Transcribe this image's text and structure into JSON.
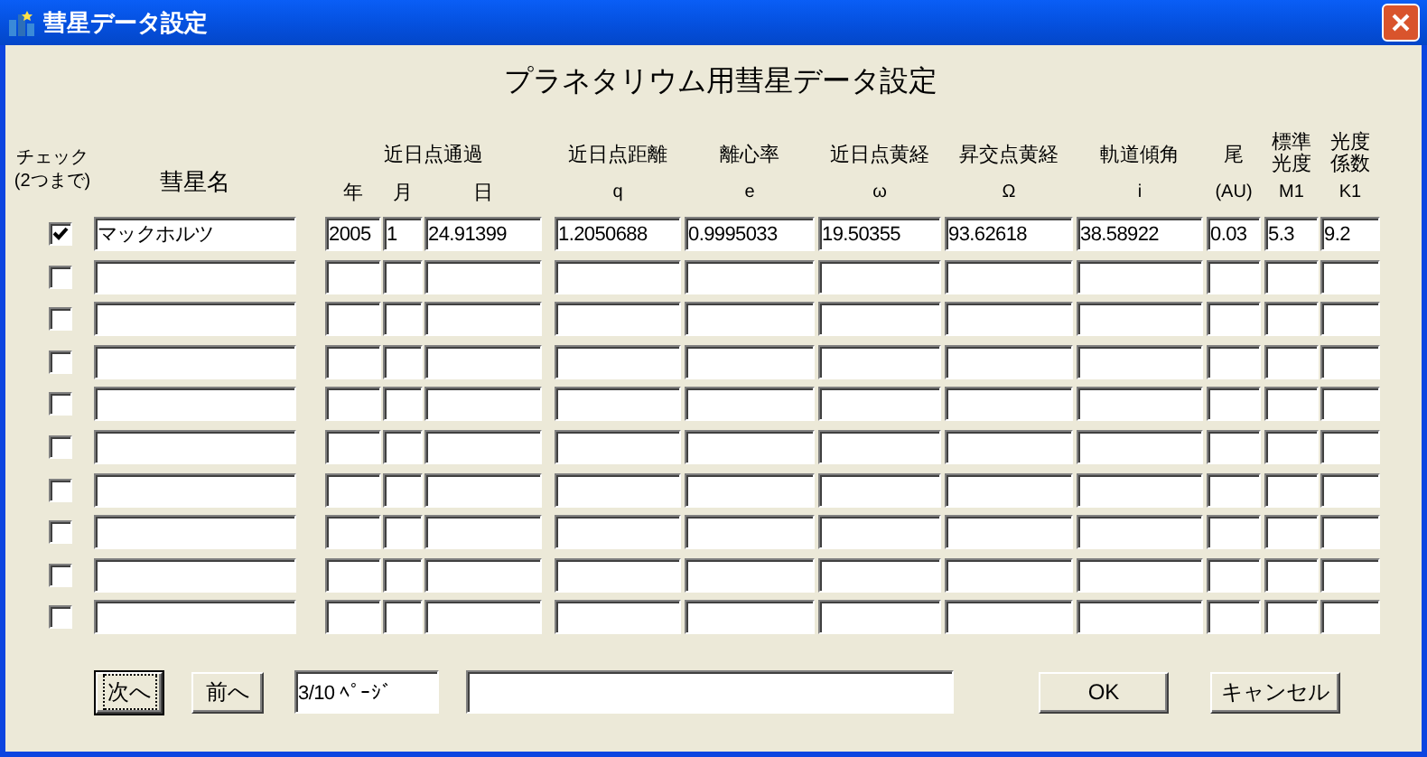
{
  "window": {
    "title": "彗星データ設定"
  },
  "heading": "プラネタリウム用彗星データ設定",
  "check_header": {
    "label": "チェック",
    "note": "(2つまで)"
  },
  "name_header": "彗星名",
  "perihelion_header": {
    "label": "近日点通過",
    "year": "年",
    "month": "月",
    "day": "日"
  },
  "element_columns": [
    {
      "label": "近日点距離",
      "symbol": "q"
    },
    {
      "label": "離心率",
      "symbol": "e"
    },
    {
      "label": "近日点黄経",
      "symbol": "ω"
    },
    {
      "label": "昇交点黄経",
      "symbol": "Ω"
    },
    {
      "label": "軌道傾角",
      "symbol": "i"
    },
    {
      "label": "尾",
      "symbol": "(AU)"
    },
    {
      "label": "標準光度",
      "symbol": "M1"
    },
    {
      "label": "光度係数",
      "symbol": "K1"
    }
  ],
  "rows": [
    {
      "checked": true,
      "name": "マックホルツ",
      "year": "2005",
      "month": "1",
      "day": "24.91399",
      "elements": [
        "1.2050688",
        "0.9995033",
        "19.50355",
        "93.62618",
        "38.58922",
        "0.03",
        "5.3",
        "9.2"
      ]
    },
    {
      "checked": false
    },
    {
      "checked": false
    },
    {
      "checked": false
    },
    {
      "checked": false
    },
    {
      "checked": false
    },
    {
      "checked": false
    },
    {
      "checked": false
    },
    {
      "checked": false
    },
    {
      "checked": false
    }
  ],
  "nav_buttons": [
    {
      "label": "次へ",
      "focused": true
    },
    {
      "label": "前へ",
      "focused": false
    }
  ],
  "page_field": {
    "value": "3/10 ﾍﾟｰｼﾞ"
  },
  "dialog_buttons": [
    {
      "label": "OK",
      "focused": false
    },
    {
      "label": "キャンセル",
      "focused": false
    }
  ]
}
